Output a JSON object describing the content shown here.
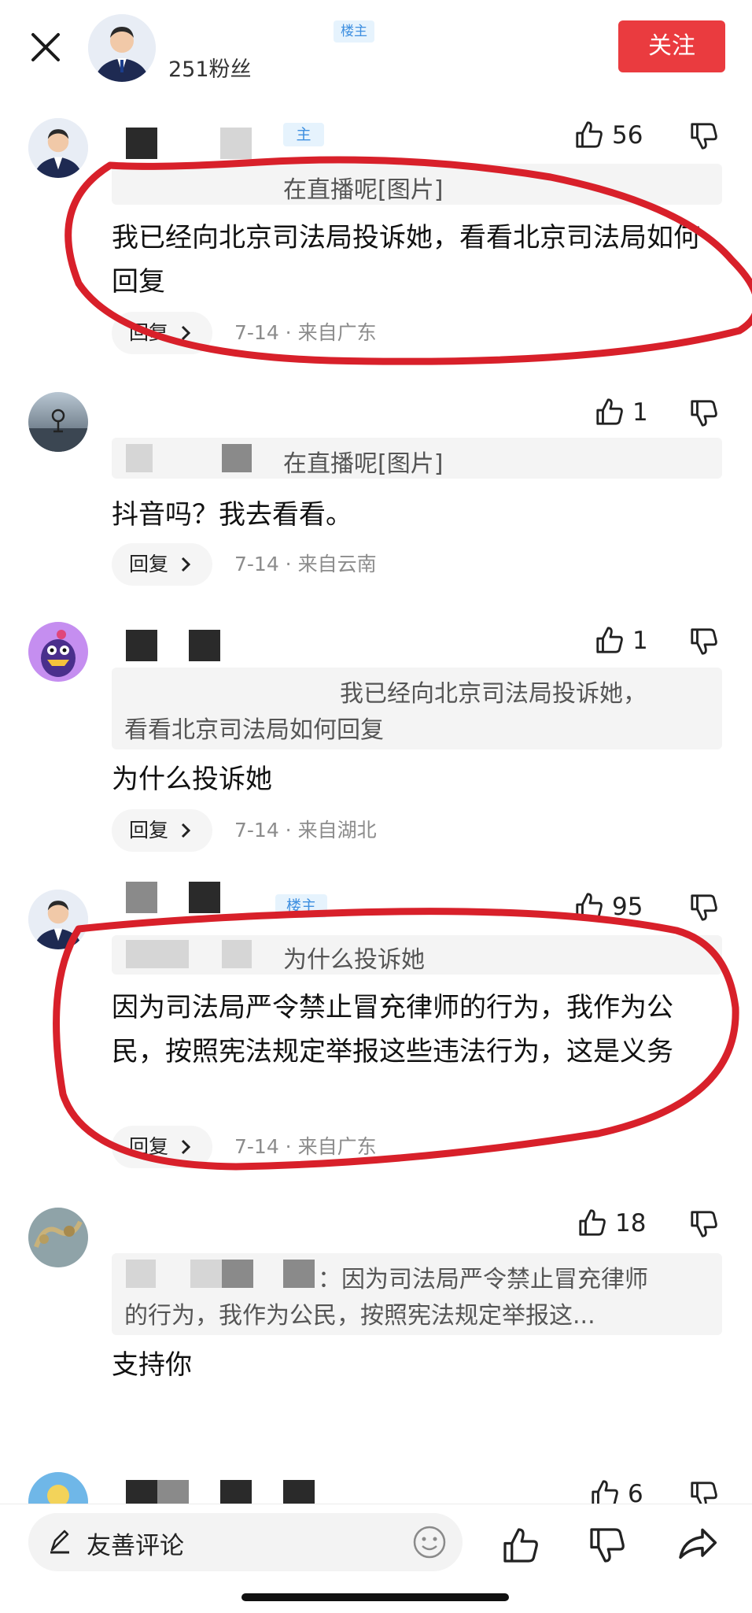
{
  "header": {
    "fans": "251粉丝",
    "louzhu_tag": "楼主",
    "follow_label": "关注"
  },
  "comments": [
    {
      "louzhu_tag": "主",
      "likes": "56",
      "quote": "在直播呢[图片]",
      "body": "我已经向北京司法局投诉她，看看北京司法局如何回复",
      "reply_label": "回复",
      "meta": "7-14 · 来自广东"
    },
    {
      "likes": "1",
      "quote": "在直播呢[图片]",
      "body": "抖音吗？我去看看。",
      "reply_label": "回复",
      "meta": "7-14 · 来自云南"
    },
    {
      "likes": "1",
      "quote_line1": "我已经向北京司法局投诉她，",
      "quote_line2": "看看北京司法局如何回复",
      "body": "为什么投诉她",
      "reply_label": "回复",
      "meta": "7-14 · 来自湖北"
    },
    {
      "louzhu_tag": "楼主",
      "likes": "95",
      "quote": "为什么投诉她",
      "body": "因为司法局严令禁止冒充律师的行为，我作为公民，按照宪法规定举报这些违法行为，这是义务",
      "reply_label": "回复",
      "meta": "7-14 · 来自广东"
    },
    {
      "likes": "18",
      "quote_line1": "：因为司法局严令禁止冒充律师",
      "quote_line2": "的行为，我作为公民，按照宪法规定举报这...",
      "body": "支持你"
    },
    {
      "likes": "6"
    }
  ],
  "bottom": {
    "comment_placeholder": "友善评论"
  },
  "colors": {
    "follow": "#ea3b3f",
    "louzhu_tag_bg": "#e6f3fd",
    "louzhu_tag_text": "#3e8fe0",
    "annotation": "#d8202a"
  },
  "icons": [
    "close-icon",
    "pen-icon",
    "emoji-icon",
    "like-icon",
    "dislike-icon",
    "share-icon",
    "chevron-right-icon"
  ]
}
